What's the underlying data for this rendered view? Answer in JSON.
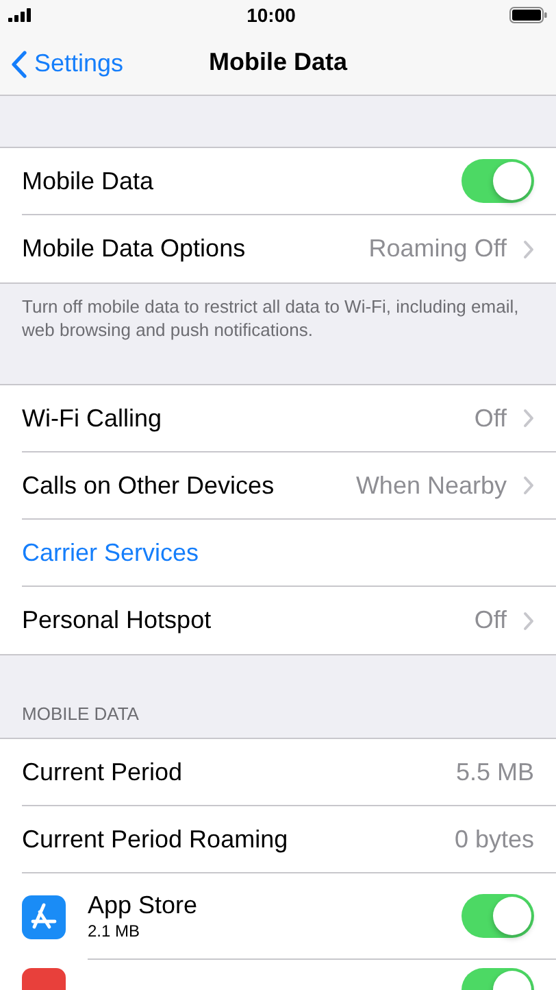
{
  "status_bar": {
    "time": "10:00"
  },
  "nav": {
    "back": "Settings",
    "title": "Mobile Data"
  },
  "groups": [
    {
      "rows": [
        {
          "kind": "toggle",
          "label": "Mobile Data",
          "on": true
        },
        {
          "kind": "detail",
          "label": "Mobile Data Options",
          "value": "Roaming Off"
        }
      ],
      "footer": "Turn off mobile data to restrict all data to Wi-Fi, including email, web browsing and push notifications."
    },
    {
      "rows": [
        {
          "kind": "detail",
          "label": "Wi-Fi Calling",
          "value": "Off"
        },
        {
          "kind": "detail",
          "label": "Calls on Other Devices",
          "value": "When Nearby"
        },
        {
          "kind": "link",
          "label": "Carrier Services"
        },
        {
          "kind": "detail",
          "label": "Personal Hotspot",
          "value": "Off"
        }
      ]
    },
    {
      "header": "MOBILE DATA",
      "rows": [
        {
          "kind": "plain",
          "label": "Current Period",
          "value": "5.5 MB"
        },
        {
          "kind": "plain",
          "label": "Current Period Roaming",
          "value": "0 bytes"
        },
        {
          "kind": "app",
          "label": "App Store",
          "sub": "2.1 MB",
          "on": true,
          "color": "#1a8cf6"
        },
        {
          "kind": "app",
          "on": true,
          "color": "#e8403b"
        }
      ]
    }
  ]
}
